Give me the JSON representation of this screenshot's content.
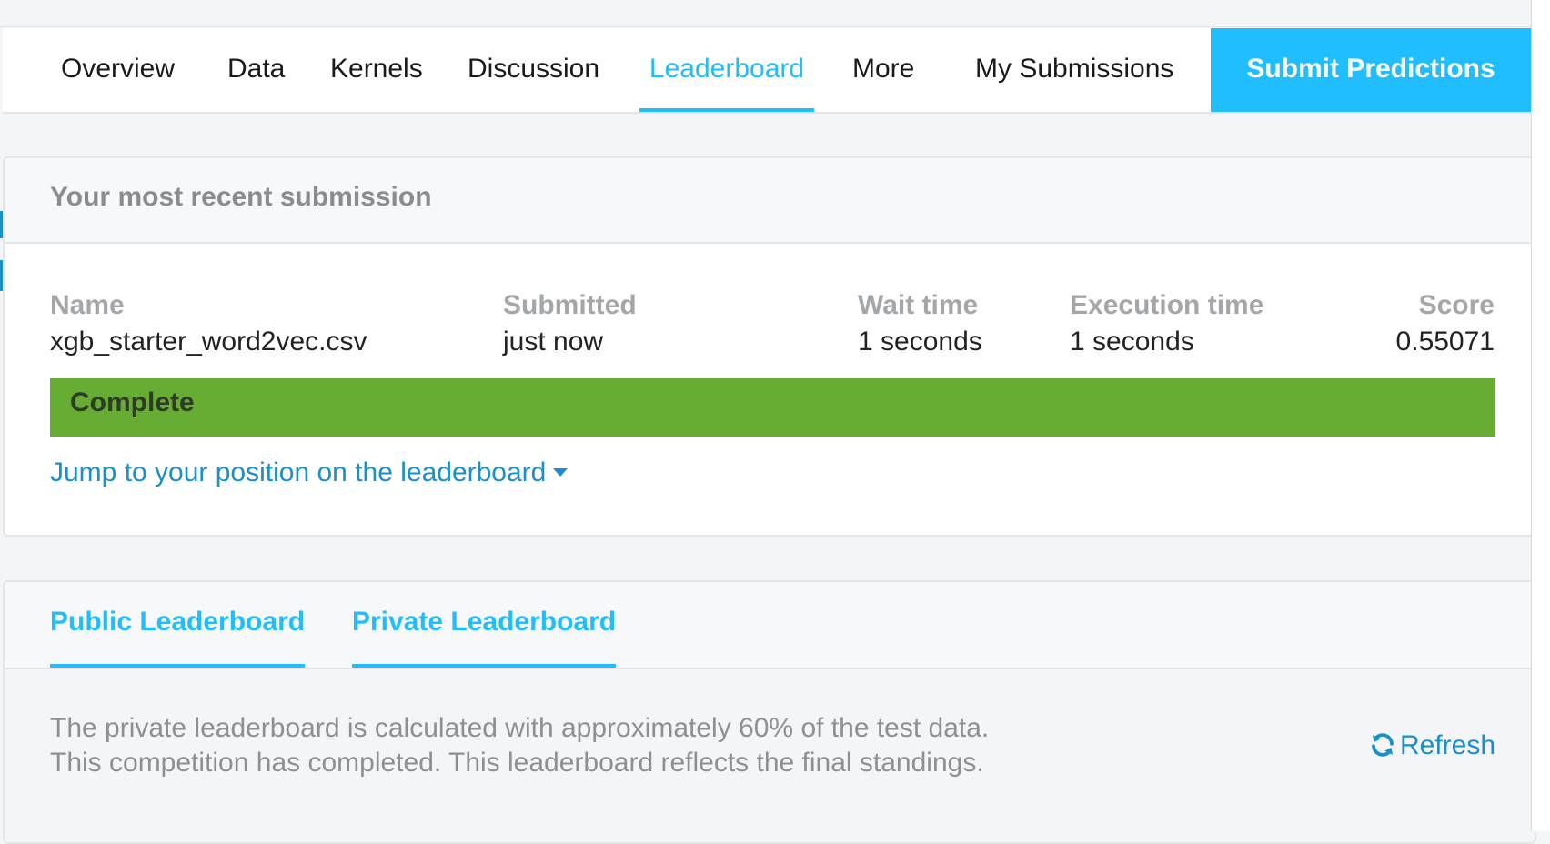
{
  "nav": {
    "items": [
      {
        "label": "Overview"
      },
      {
        "label": "Data"
      },
      {
        "label": "Kernels"
      },
      {
        "label": "Discussion"
      },
      {
        "label": "Leaderboard",
        "active": true
      },
      {
        "label": "More"
      },
      {
        "label": "My Submissions"
      }
    ],
    "submit_label": "Submit Predictions"
  },
  "recent": {
    "title": "Your most recent submission",
    "columns": {
      "name_label": "Name",
      "submitted_label": "Submitted",
      "wait_label": "Wait time",
      "exec_label": "Execution time",
      "score_label": "Score"
    },
    "values": {
      "name": "xgb_starter_word2vec.csv",
      "submitted": "just now",
      "wait": "1 seconds",
      "exec": "1 seconds",
      "score": "0.55071"
    },
    "status": "Complete",
    "jump_link": "Jump to your position on the leaderboard"
  },
  "leaderboard": {
    "tabs": [
      {
        "label": "Public Leaderboard"
      },
      {
        "label": "Private Leaderboard"
      }
    ],
    "info_line1": "The private leaderboard is calculated with approximately 60% of the test data.",
    "info_line2": "This competition has completed. This leaderboard reflects the final standings.",
    "refresh_label": "Refresh"
  },
  "colors": {
    "accent": "#20beff",
    "link": "#1a8fc8",
    "status_complete": "#67ad33"
  },
  "icons": {
    "refresh": "refresh-icon",
    "caret": "caret-down-icon"
  }
}
